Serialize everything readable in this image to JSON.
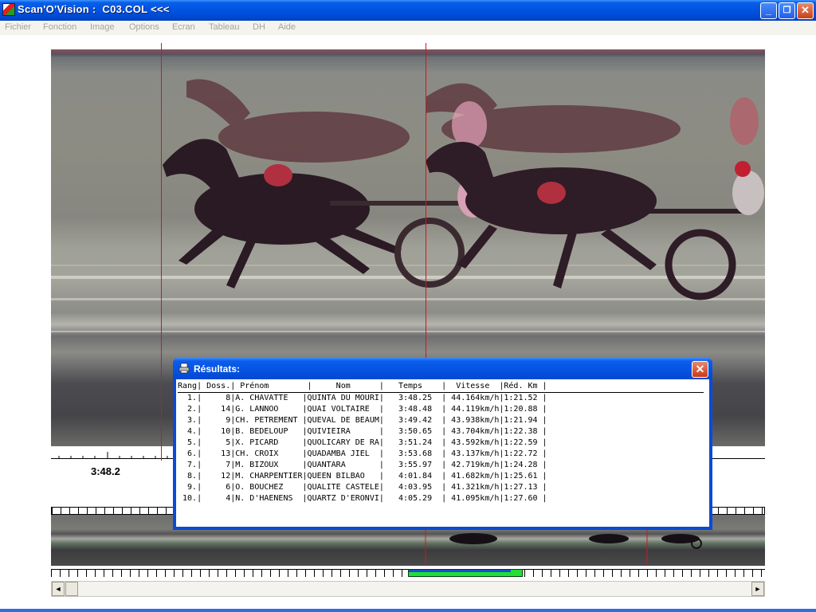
{
  "window": {
    "title": "Scan'O'Vision :  C03.COL <<<",
    "controls": {
      "minimize": "_",
      "restore": "❐",
      "close": "✕"
    }
  },
  "menu": [
    "Fichier",
    "Fonction",
    "Image",
    "Options",
    "Ecran",
    "Tableau",
    "DH",
    "Aide"
  ],
  "photo": {
    "time_label": "3:48.2"
  },
  "dialog": {
    "title": "Résultats:",
    "close": "✕",
    "header": "Rang| Doss.| Prénom        |     Nom      |   Temps    |  Vitesse  |Réd. Km |",
    "rows": [
      "  1.|     8|A. CHAVATTE   |QUINTA DU MOURI|   3:48.25  | 44.164km/h|1:21.52 |",
      "  2.|    14|G. LANNOO     |QUAI VOLTAIRE  |   3:48.48  | 44.119km/h|1:20.88 |",
      "  3.|     9|CH. PETREMENT |QUEVAL DE BEAUM|   3:49.42  | 43.938km/h|1:21.94 |",
      "  4.|    10|B. BEDELOUP   |QUIVIEIRA      |   3:50.65  | 43.704km/h|1:22.38 |",
      "  5.|     5|X. PICARD     |QUOLICARY DE RA|   3:51.24  | 43.592km/h|1:22.59 |",
      "  6.|    13|CH. CROIX     |QUADAMBA JIEL  |   3:53.68  | 43.137km/h|1:22.72 |",
      "  7.|     7|M. BIZOUX     |QUANTARA       |   3:55.97  | 42.719km/h|1:24.28 |",
      "  8.|    12|M. CHARPENTIER|QUEEN BILBAO   |   4:01.84  | 41.682km/h|1:25.61 |",
      "  9.|     6|O. BOUCHEZ    |QUALITE CASTELE|   4:03.95  | 41.321km/h|1:27.13 |",
      " 10.|     4|N. D'HAENENS  |QUARTZ D'ERONVI|   4:05.29  | 41.095km/h|1:27.60 |"
    ]
  },
  "scrollbar": {
    "left": "◄",
    "right": "►"
  }
}
